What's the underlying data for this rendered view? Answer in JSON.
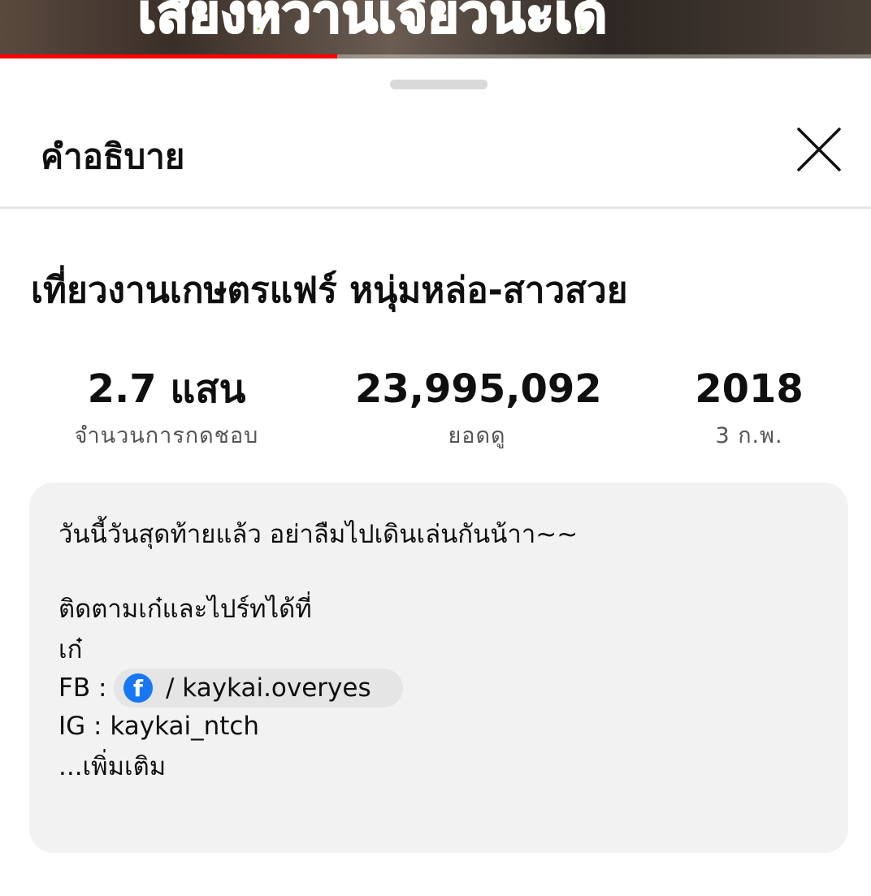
{
  "video": {
    "caption": "เสียงหวานเจี๊ยวนะเด้",
    "progress_percent": 38.7
  },
  "sheet": {
    "title": "คำอธิบาย",
    "close_icon": "close-icon"
  },
  "video_title": "เที่ยวงานเกษตรแฟร์ หนุ่มหล่อ-สาวสวย",
  "stats": [
    {
      "value": "2.7 แสน",
      "label": "จำนวนการกดชอบ"
    },
    {
      "value": "23,995,092",
      "label": "ยอดดู"
    },
    {
      "value": "2018",
      "label": "3 ก.พ."
    }
  ],
  "description": {
    "line1": "วันนี้วันสุดท้ายแล้ว อย่าลืมไปเดินเล่นกันน้าา~~",
    "line2": "ติดตามเก๋และไปร์ทได้ที่",
    "line3": "เก๋",
    "fb_prefix": "FB :",
    "fb_link": "/ kaykai.overyes",
    "fb_icon": "facebook-icon",
    "ig_line": "IG : kaykai_ntch",
    "more": "...เพิ่มเติม"
  },
  "colors": {
    "progress": "#ff0000",
    "facebook": "#1877f2",
    "caption": "#9bea3a"
  }
}
